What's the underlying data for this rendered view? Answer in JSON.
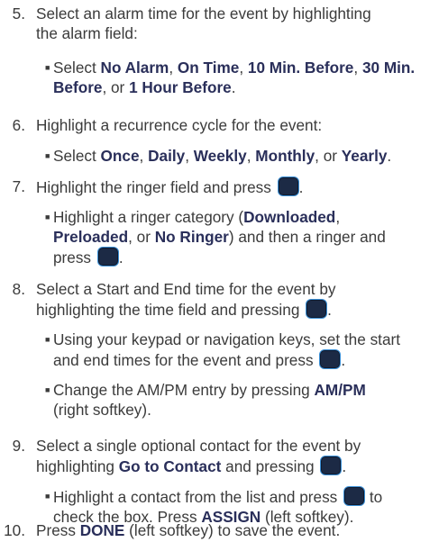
{
  "steps": [
    {
      "n": "5.",
      "t1": "Select an alarm time for the event by highlighting",
      "t2": "the alarm field:"
    },
    {
      "n": "6.",
      "t1": "Highlight a recurrence cycle for the event:"
    },
    {
      "n": "7.",
      "t1": "Highlight the ringer field and press",
      "end": "."
    },
    {
      "n": "8.",
      "t1": "Select a Start and End time for the event by",
      "t2": "highlighting the time field and pressing",
      "end": "."
    },
    {
      "n": "9.",
      "t1": "Select a single optional contact for the event by",
      "t2a": "highlighting ",
      "t2b": "Go to Contact",
      "t2c": " and pressing",
      "end": "."
    },
    {
      "n": "10.",
      "t1a": "Press ",
      "t1b": "DONE",
      "t1c": " (left softkey) to save the event."
    }
  ],
  "sub5": {
    "a": "Select ",
    "b": "No Alarm",
    "c": ", ",
    "d": "On Time",
    "e": ", ",
    "f": "10 Min. Before",
    "g": ", ",
    "h": "30 Min.",
    "i": "Before",
    "j": ", or ",
    "k": "1 Hour Before",
    "l": "."
  },
  "sub6": {
    "a": "Select ",
    "b": "Once",
    "c": ", ",
    "d": "Daily",
    "e": ", ",
    "f": "Weekly",
    "g": ", ",
    "h": "Monthly",
    "i": ", or ",
    "j": "Yearly",
    "k": "."
  },
  "sub7": {
    "a": "Highlight a ringer category (",
    "b": "Downloaded",
    "c": ",",
    "d": "Preloaded",
    "e": ", or ",
    "f": "No Ringer",
    "g": ") and then a ringer and",
    "h": "press",
    "i": "."
  },
  "sub8a": {
    "l1": "Using your keypad or navigation keys, set the start",
    "l2": "and end times for the event and press",
    "end": "."
  },
  "sub8b": {
    "a": "Change the AM/PM entry by pressing ",
    "b": "AM/PM",
    "l2": "(right softkey)."
  },
  "sub9": {
    "a": "Highlight a contact from the list and press",
    "b": " to",
    "c": "check the box. Press ",
    "d": "ASSIGN",
    "e": " (left softkey)."
  },
  "bullet": "■",
  "key_icon": "ok-menu-key-icon",
  "colors": {
    "text": "#3b3b3b",
    "bold": "#2a2f5a",
    "key": "#1c2a45",
    "key_border": "#3a8fd6"
  }
}
